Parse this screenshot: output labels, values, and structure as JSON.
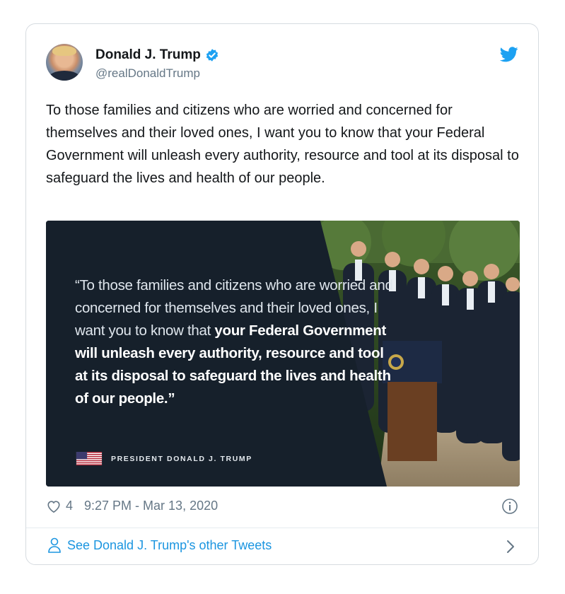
{
  "author": {
    "name": "Donald J. Trump",
    "handle": "@realDonaldTrump"
  },
  "tweet": {
    "text": "To those families and citizens who are worried and concerned for themselves and their loved ones, I want you to know that your Federal Government will unleash every authority, resource and tool at its disposal to safeguard the lives and health of our people."
  },
  "media": {
    "quote_regular": "“To those families and citizens who are worried and concerned for themselves and their loved ones, I want you to know that ",
    "quote_bold": "your Federal Government will unleash every authority, resource and tool at its disposal to safeguard the lives and health of our people.”",
    "signature": "PRESIDENT DONALD J. TRUMP"
  },
  "meta": {
    "likes": "4",
    "timestamp": "9:27 PM - Mar 13, 2020"
  },
  "footer": {
    "link_label": "See Donald J. Trump's other Tweets"
  },
  "colors": {
    "brand_blue": "#1da1f2",
    "link_blue": "#1b95e0",
    "muted_gray": "#657786",
    "media_dark": "#16202b"
  },
  "icons": [
    "verified-badge-icon",
    "twitter-bird-icon",
    "heart-icon",
    "info-icon",
    "person-icon",
    "chevron-right-icon",
    "us-flag-icon"
  ]
}
